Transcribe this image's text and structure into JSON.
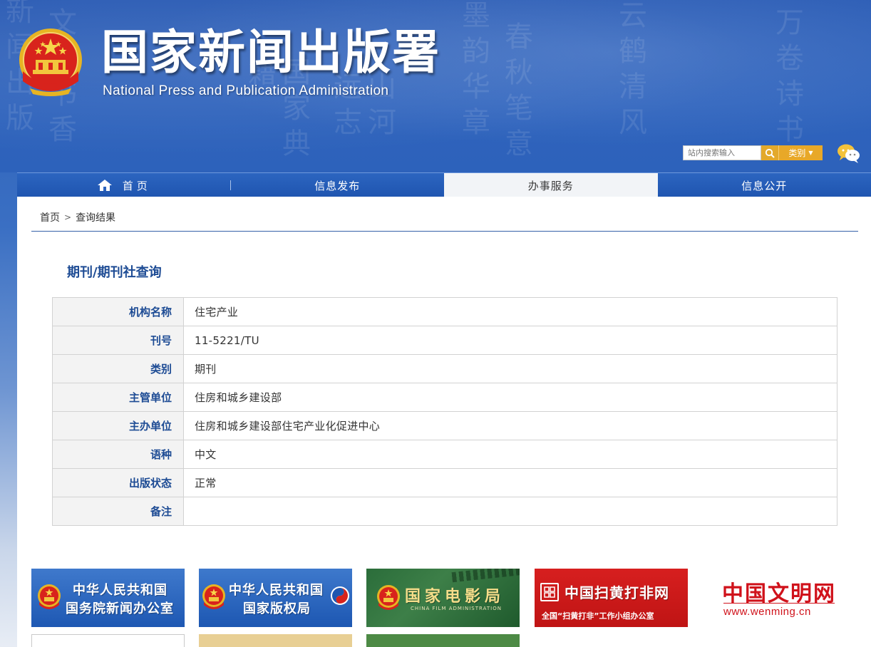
{
  "header": {
    "title_cn": "国家新闻出版署",
    "title_en": "National  Press and Publication Administration",
    "search_placeholder": "站内搜索输入",
    "category_label": "类别",
    "calligraphy_chars": [
      "新闻出版",
      "文化书香",
      "国家典籍",
      "山河远志",
      "墨韵华章",
      "春秋笔意",
      "云鹤清风",
      "万卷诗书"
    ]
  },
  "nav": {
    "items": [
      {
        "label": "首页",
        "active": false
      },
      {
        "label": "信息发布",
        "active": false
      },
      {
        "label": "办事服务",
        "active": true
      },
      {
        "label": "信息公开",
        "active": false
      }
    ]
  },
  "breadcrumb": {
    "home": "首页",
    "separator": ">",
    "current": "查询结果"
  },
  "query": {
    "title": "期刊/期刊社查询",
    "rows": [
      {
        "label": "机构名称",
        "value": "住宅产业"
      },
      {
        "label": "刊号",
        "value": "11-5221/TU"
      },
      {
        "label": "类别",
        "value": "期刊"
      },
      {
        "label": "主管单位",
        "value": "住房和城乡建设部"
      },
      {
        "label": "主办单位",
        "value": "住房和城乡建设部住宅产业化促进中心"
      },
      {
        "label": "语种",
        "value": "中文"
      },
      {
        "label": "出版状态",
        "value": "正常"
      },
      {
        "label": "备注",
        "value": ""
      }
    ]
  },
  "banners": [
    {
      "line1": "中华人民共和国",
      "line2": "国务院新闻办公室"
    },
    {
      "line1": "中华人民共和国",
      "line2": "国家版权局"
    },
    {
      "line1": "国家电影局",
      "line2": "CHINA FILM ADMINISTRATION"
    },
    {
      "line1": "中国扫黄打非网",
      "line2": "全国“扫黄打非”工作小组办公室"
    },
    {
      "line1": "中国文明网",
      "line2": "www.wenming.cn"
    }
  ],
  "colors": {
    "header_blue": "#2d62bb",
    "nav_blue": "#1f55b0",
    "title_blue": "#1d4b94",
    "accent_orange": "#e8a828",
    "red": "#d0121b"
  }
}
